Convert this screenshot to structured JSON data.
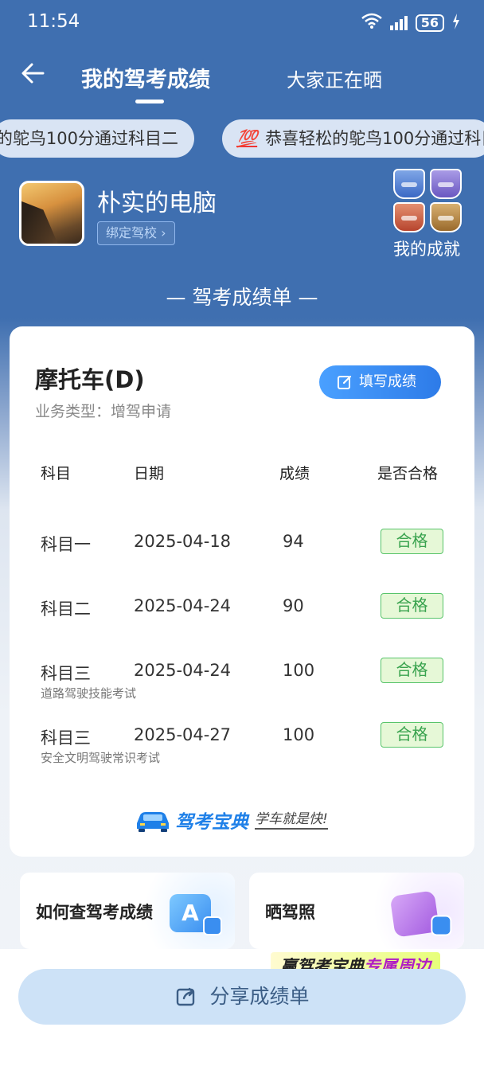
{
  "status": {
    "time": "11:54",
    "battery": "56"
  },
  "nav": {
    "title": "我的驾考成绩",
    "tab2": "大家正在晒"
  },
  "ticker": {
    "item1": "的鸵鸟100分通过科目二",
    "item2_icon": "💯",
    "item2": "恭喜轻松的鸵鸟100分通过科目"
  },
  "profile": {
    "name": "朴实的电脑",
    "bind_label": "绑定驾校 ›",
    "achievements_label": "我的成就"
  },
  "section_title": "— 驾考成绩单 —",
  "card": {
    "vehicle": "摩托车(D)",
    "business_type": "业务类型：增驾申请",
    "fill_button": "填写成绩",
    "headers": {
      "subject": "科目",
      "date": "日期",
      "score": "成绩",
      "pass": "是否合格"
    },
    "rows": [
      {
        "subject": "科目一",
        "date": "2025-04-18",
        "score": "94",
        "pass": "合格",
        "note": ""
      },
      {
        "subject": "科目二",
        "date": "2025-04-24",
        "score": "90",
        "pass": "合格",
        "note": ""
      },
      {
        "subject": "科目三",
        "date": "2025-04-24",
        "score": "100",
        "pass": "合格",
        "note": "道路驾驶技能考试"
      },
      {
        "subject": "科目三",
        "date": "2025-04-27",
        "score": "100",
        "pass": "合格",
        "note": "安全文明驾驶常识考试"
      }
    ],
    "brand_name": "驾考宝典",
    "brand_slogan": "学车就是快!"
  },
  "links": {
    "how_to_check": "如何查驾考成绩",
    "show_license": "晒驾照",
    "icon_letter": "A"
  },
  "promo": {
    "part1": "赢驾考宝典",
    "part2": "专属周边"
  },
  "share_button": "分享成绩单",
  "colors": {
    "header_blue": "#3f6fb0",
    "accent_blue": "#2d7be8",
    "pass_green": "#3aa34f"
  }
}
